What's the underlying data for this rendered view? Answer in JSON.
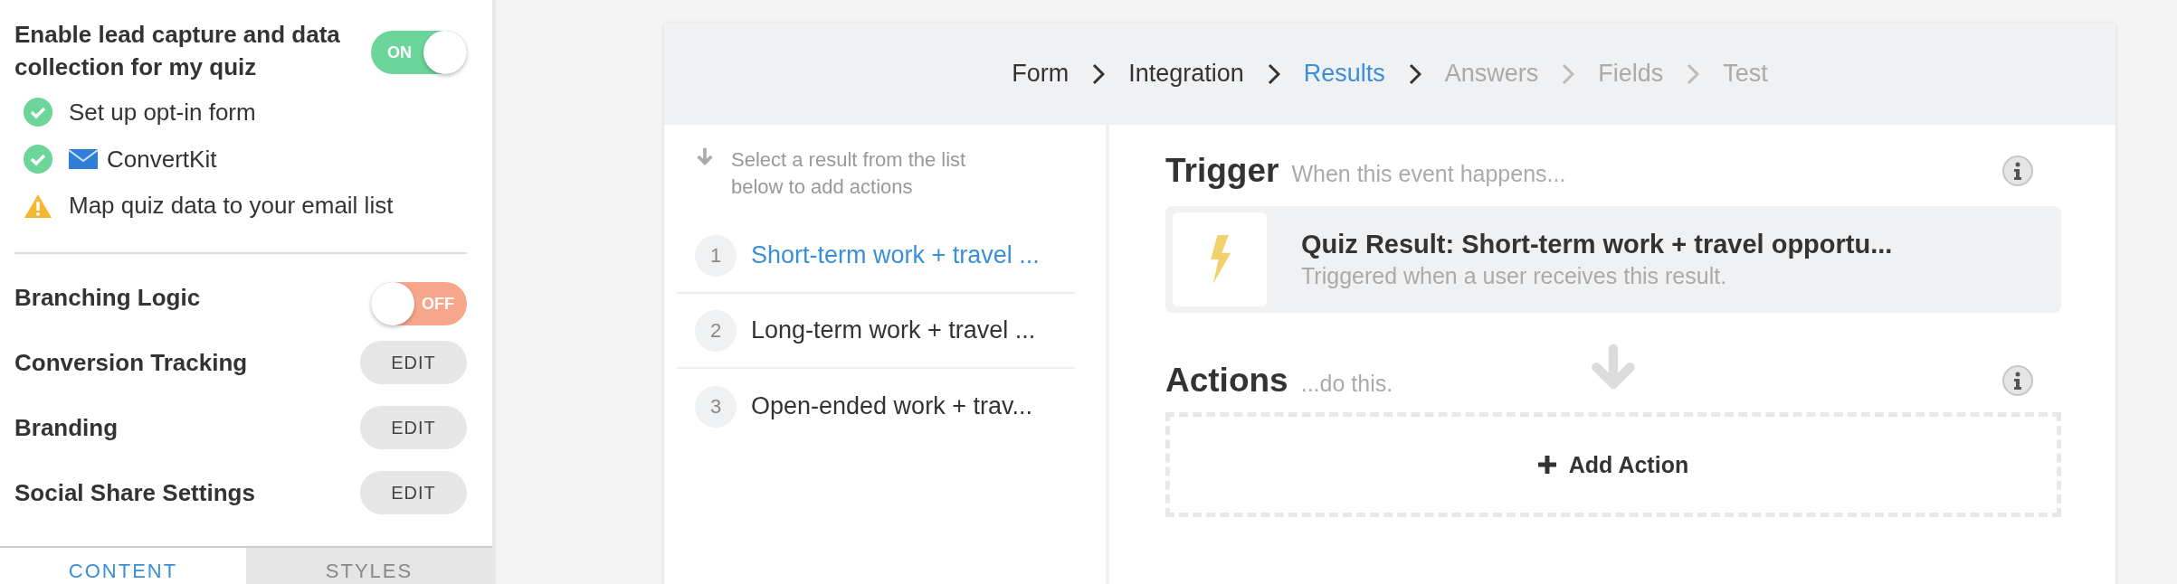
{
  "sidebar": {
    "lead_capture": {
      "label": "Enable lead capture and data collection for my quiz",
      "toggle_label": "ON",
      "on": true
    },
    "checklist": [
      {
        "kind": "check",
        "label": "Set up opt-in form"
      },
      {
        "kind": "integration",
        "label": "ConvertKit"
      },
      {
        "kind": "warning",
        "label": "Map quiz data to your email list"
      }
    ],
    "settings": [
      {
        "kind": "toggle",
        "label": "Branching Logic",
        "toggle_label": "OFF",
        "on": false
      },
      {
        "kind": "edit",
        "label": "Conversion Tracking",
        "button": "EDIT"
      },
      {
        "kind": "edit",
        "label": "Branding",
        "button": "EDIT"
      },
      {
        "kind": "edit",
        "label": "Social Share Settings",
        "button": "EDIT"
      }
    ],
    "tabs": [
      {
        "label": "CONTENT",
        "selected": true
      },
      {
        "label": "STYLES",
        "selected": false
      }
    ]
  },
  "steps": [
    {
      "label": "Form",
      "selected": false,
      "disabled": false
    },
    {
      "label": "Integration",
      "selected": false,
      "disabled": false
    },
    {
      "label": "Results",
      "selected": true,
      "disabled": false
    },
    {
      "label": "Answers",
      "selected": false,
      "disabled": true
    },
    {
      "label": "Fields",
      "selected": false,
      "disabled": true
    },
    {
      "label": "Test",
      "selected": false,
      "disabled": true
    }
  ],
  "results": {
    "hint": "Select a result from the list below to add actions",
    "items": [
      {
        "number": "1",
        "title": "Short-term work + travel ...",
        "selected": true
      },
      {
        "number": "2",
        "title": "Long-term work + travel ...",
        "selected": false
      },
      {
        "number": "3",
        "title": "Open-ended work + trav...",
        "selected": false
      }
    ]
  },
  "trigger": {
    "heading": "Trigger",
    "subheading": "When this event happens...",
    "card": {
      "title": "Quiz Result: Short-term work + travel opportu...",
      "subtitle": "Triggered when a user receives this result."
    }
  },
  "actions": {
    "heading": "Actions",
    "subheading": "...do this.",
    "add_button": "Add Action"
  }
}
